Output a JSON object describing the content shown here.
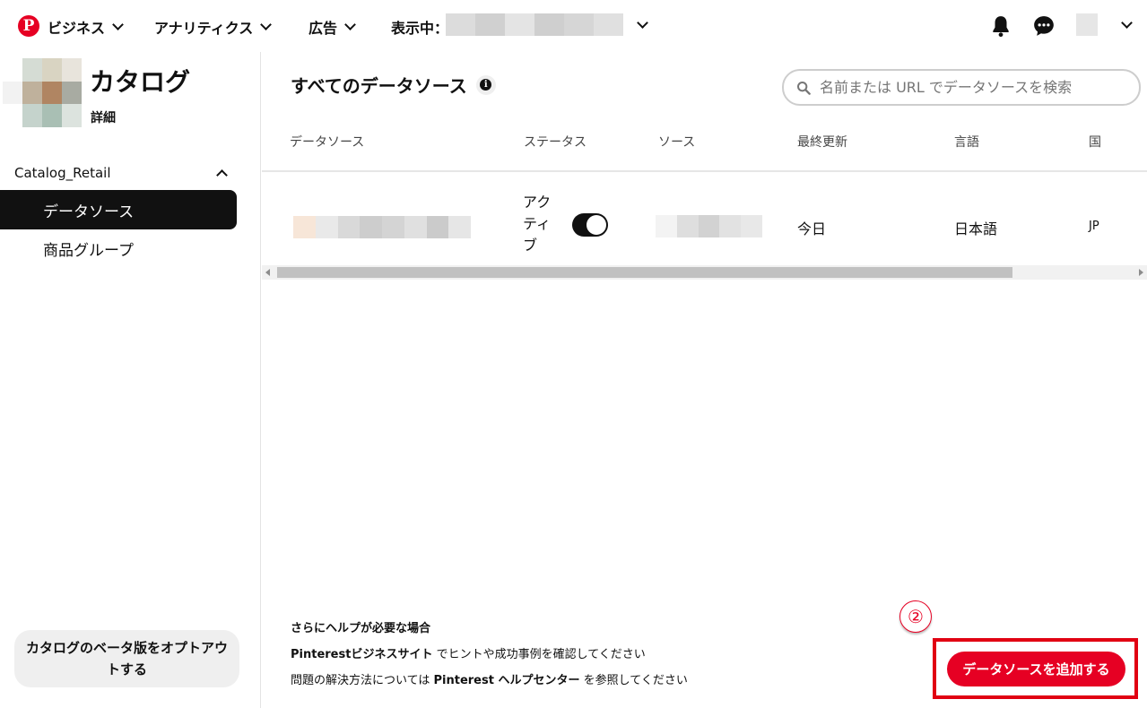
{
  "topbar": {
    "logo_letter": "P",
    "business": "ビジネス",
    "analytics": "アナリティクス",
    "ads": "広告",
    "viewing_label": "表示中："
  },
  "sidebar": {
    "catalog_title": "カタログ",
    "catalog_sub": "詳細",
    "section_name": "Catalog_Retail",
    "items": [
      {
        "label": "データソース",
        "active": true
      },
      {
        "label": "商品グループ",
        "active": false
      }
    ],
    "optout_label": "カタログのベータ版をオプトアウトする"
  },
  "main": {
    "title": "すべてのデータソース",
    "info_glyph": "i",
    "search_placeholder": "名前または URL でデータソースを検索",
    "columns": [
      "データソース",
      "ステータス",
      "ソース",
      "最終更新",
      "言語",
      "国"
    ],
    "row": {
      "status": "アクティブ",
      "last_updated": "今日",
      "language": "日本語",
      "country": "JP"
    }
  },
  "help": {
    "heading": "さらにヘルプが必要な場合",
    "line1_bold": "Pinterestビジネスサイト",
    "line1_rest": " でヒントや成功事例を確認してください",
    "line2_pre": "問題の解決方法については ",
    "line2_bold": "Pinterest ヘルプセンター",
    "line2_post": " を参照してください"
  },
  "annotation": "②",
  "add_button": "データソースを追加する",
  "colors": {
    "brand": "#e60023",
    "annotation_box": "#e10012"
  }
}
